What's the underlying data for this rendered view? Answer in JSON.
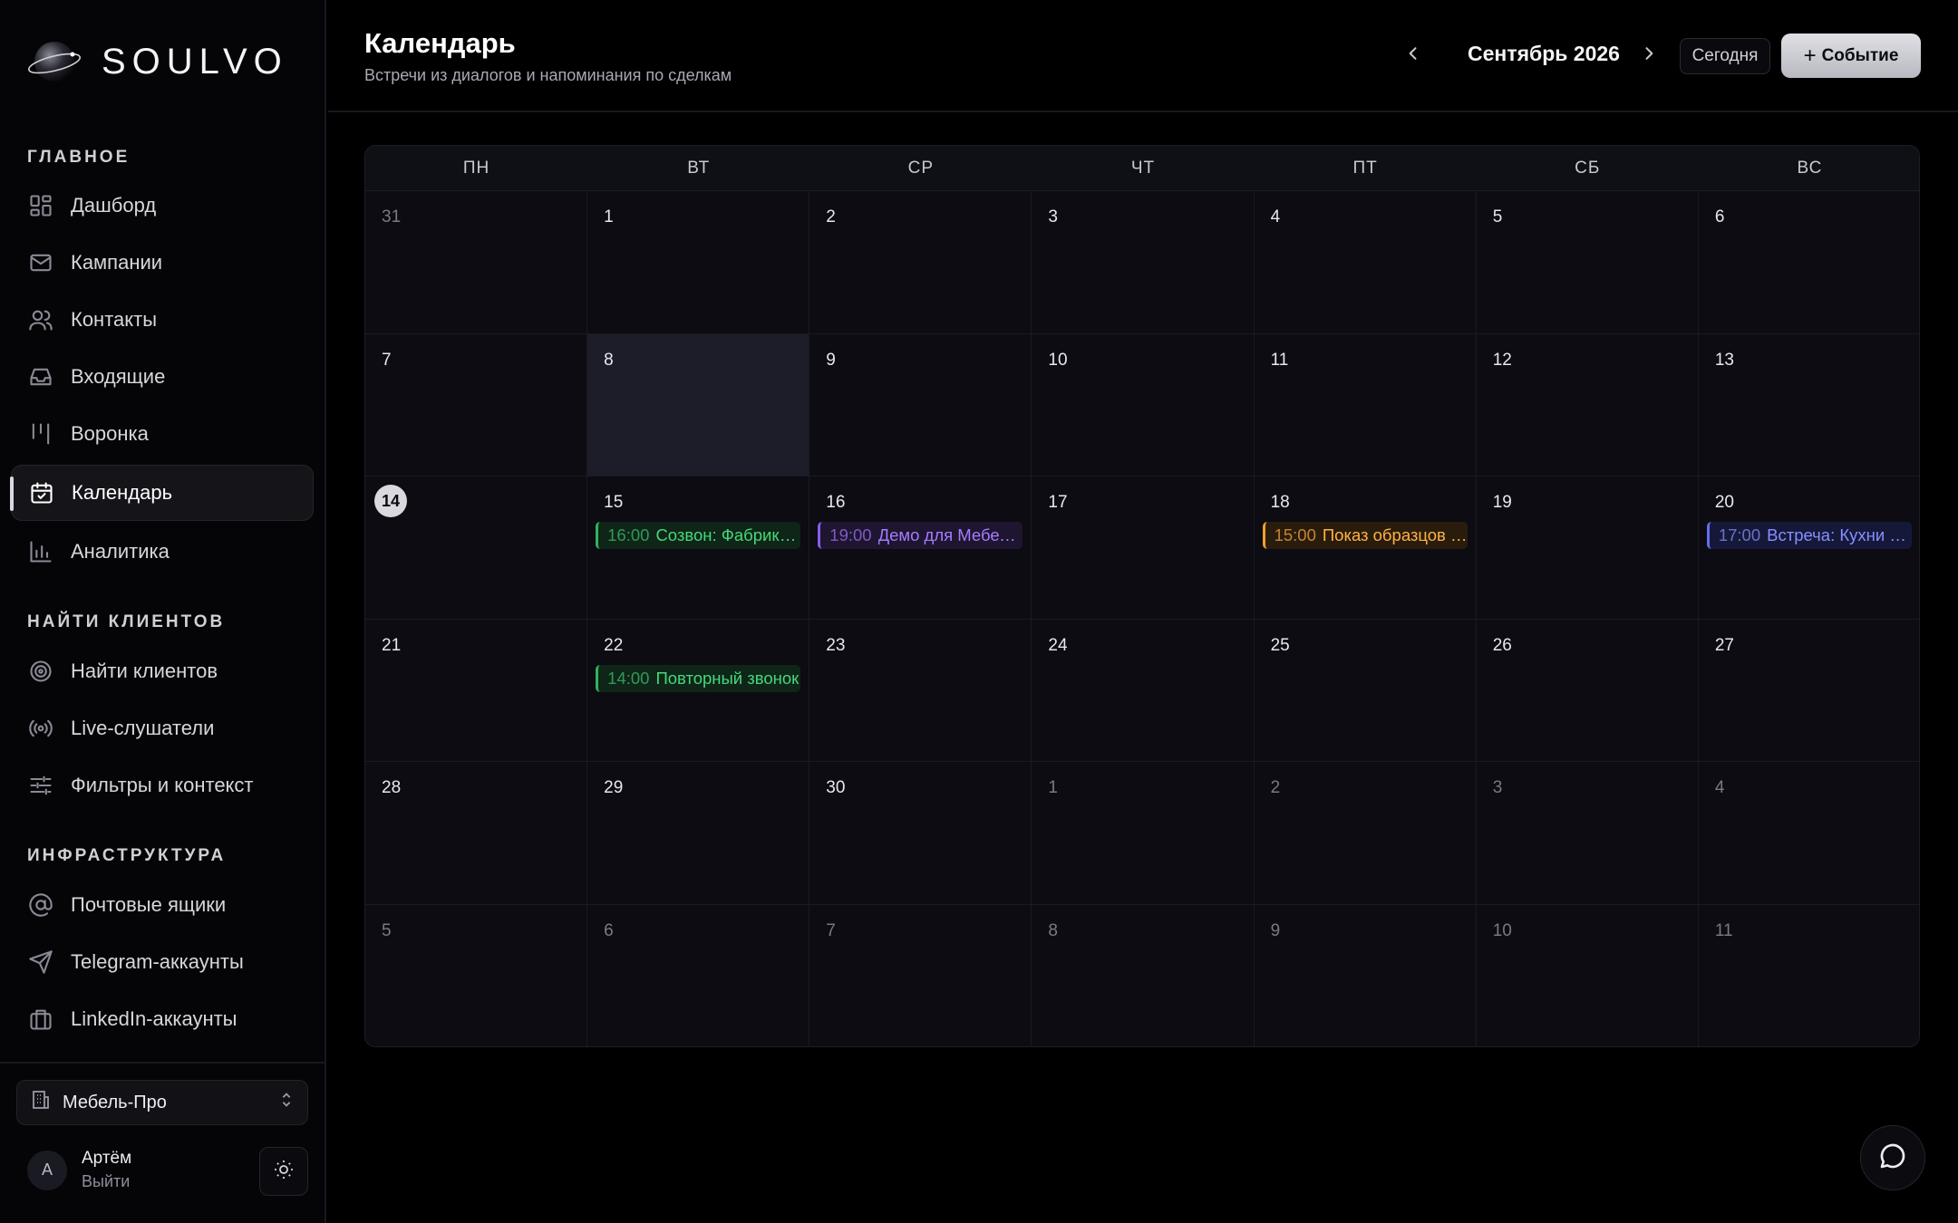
{
  "brand": {
    "name": "SOULVO"
  },
  "sidebar": {
    "sections": [
      {
        "title": "ГЛАВНОЕ"
      },
      {
        "title": "НАЙТИ КЛИЕНТОВ"
      },
      {
        "title": "ИНФРАСТРУКТУРА"
      }
    ],
    "items": [
      {
        "label": "Дашборд",
        "icon": "dashboard-icon"
      },
      {
        "label": "Кампании",
        "icon": "mail-icon"
      },
      {
        "label": "Контакты",
        "icon": "users-icon"
      },
      {
        "label": "Входящие",
        "icon": "inbox-icon"
      },
      {
        "label": "Воронка",
        "icon": "kanban-icon"
      },
      {
        "label": "Календарь",
        "icon": "calendar-check-icon",
        "active": true
      },
      {
        "label": "Аналитика",
        "icon": "bar-chart-icon"
      },
      {
        "label": "Найти клиентов",
        "icon": "target-icon"
      },
      {
        "label": "Live-слушатели",
        "icon": "radio-icon"
      },
      {
        "label": "Фильтры и контекст",
        "icon": "sliders-icon"
      },
      {
        "label": "Почтовые ящики",
        "icon": "at-sign-icon"
      },
      {
        "label": "Telegram-аккаунты",
        "icon": "send-icon"
      },
      {
        "label": "LinkedIn-аккаунты",
        "icon": "briefcase-icon"
      }
    ],
    "workspace": {
      "name": "Мебель-Про"
    },
    "user": {
      "initial": "А",
      "name": "Артём",
      "logout": "Выйти"
    }
  },
  "header": {
    "title": "Календарь",
    "subtitle": "Встречи из диалогов и напоминания по сделкам",
    "month": "Сентябрь 2026",
    "today_label": "Сегодня",
    "event_label": "Событие"
  },
  "calendar": {
    "weekdays": [
      "ПН",
      "ВТ",
      "СР",
      "ЧТ",
      "ПТ",
      "СБ",
      "ВС"
    ],
    "weeks": [
      [
        {
          "d": "31",
          "muted": true
        },
        {
          "d": "1"
        },
        {
          "d": "2"
        },
        {
          "d": "3"
        },
        {
          "d": "4"
        },
        {
          "d": "5"
        },
        {
          "d": "6"
        }
      ],
      [
        {
          "d": "7"
        },
        {
          "d": "8",
          "selected": true
        },
        {
          "d": "9"
        },
        {
          "d": "10"
        },
        {
          "d": "11"
        },
        {
          "d": "12"
        },
        {
          "d": "13"
        }
      ],
      [
        {
          "d": "14",
          "today": true
        },
        {
          "d": "15",
          "event": {
            "time": "16:00",
            "title": "Созвон: Фабрика мебели",
            "color": "green"
          }
        },
        {
          "d": "16",
          "event": {
            "time": "19:00",
            "title": "Демо для Мебель-Про",
            "color": "purple"
          }
        },
        {
          "d": "17"
        },
        {
          "d": "18",
          "event": {
            "time": "15:00",
            "title": "Показ образцов тканей",
            "color": "orange"
          }
        },
        {
          "d": "19"
        },
        {
          "d": "20",
          "event": {
            "time": "17:00",
            "title": "Встреча: Кухни на заказ",
            "color": "blue"
          }
        }
      ],
      [
        {
          "d": "21"
        },
        {
          "d": "22",
          "event": {
            "time": "14:00",
            "title": "Повторный звонок",
            "color": "green"
          }
        },
        {
          "d": "23"
        },
        {
          "d": "24"
        },
        {
          "d": "25"
        },
        {
          "d": "26"
        },
        {
          "d": "27"
        }
      ],
      [
        {
          "d": "28"
        },
        {
          "d": "29"
        },
        {
          "d": "30"
        },
        {
          "d": "1",
          "muted": true
        },
        {
          "d": "2",
          "muted": true
        },
        {
          "d": "3",
          "muted": true
        },
        {
          "d": "4",
          "muted": true
        }
      ],
      [
        {
          "d": "5",
          "muted": true
        },
        {
          "d": "6",
          "muted": true
        },
        {
          "d": "7",
          "muted": true
        },
        {
          "d": "8",
          "muted": true
        },
        {
          "d": "9",
          "muted": true
        },
        {
          "d": "10",
          "muted": true
        },
        {
          "d": "11",
          "muted": true
        }
      ]
    ]
  },
  "colors": {
    "accent": "#d9d9de",
    "green": "#46d879",
    "purple": "#a77bff",
    "orange": "#ffb347",
    "blue": "#8690ff"
  }
}
